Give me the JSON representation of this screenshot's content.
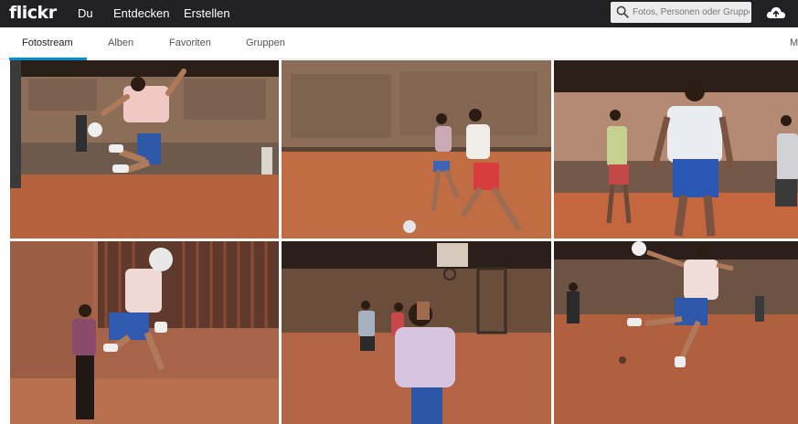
{
  "brand": {
    "logo": "flickr"
  },
  "topnav": {
    "items": [
      "Du",
      "Entdecken",
      "Erstellen"
    ]
  },
  "search": {
    "placeholder": "Fotos, Personen oder Gruppen"
  },
  "icons": {
    "search": "search-icon",
    "upload": "cloud-upload-icon"
  },
  "subnav": {
    "tabs": [
      "Fotostream",
      "Alben",
      "Favoriten",
      "Gruppen"
    ],
    "active": "Fotostream",
    "more": "M"
  },
  "colors": {
    "topbar": "#212124",
    "accent": "#008ecf",
    "court": "#b8623a",
    "wall": "#8a6a52"
  },
  "photos": [
    {
      "subject": "player jumping kicking ball in front of wall"
    },
    {
      "subject": "two players contesting ball on court"
    },
    {
      "subject": "players standing on court at night"
    },
    {
      "subject": "player jumping by metal gate"
    },
    {
      "subject": "player in lavender shirt near basketball hoop"
    },
    {
      "subject": "player jumping to head ball"
    }
  ]
}
